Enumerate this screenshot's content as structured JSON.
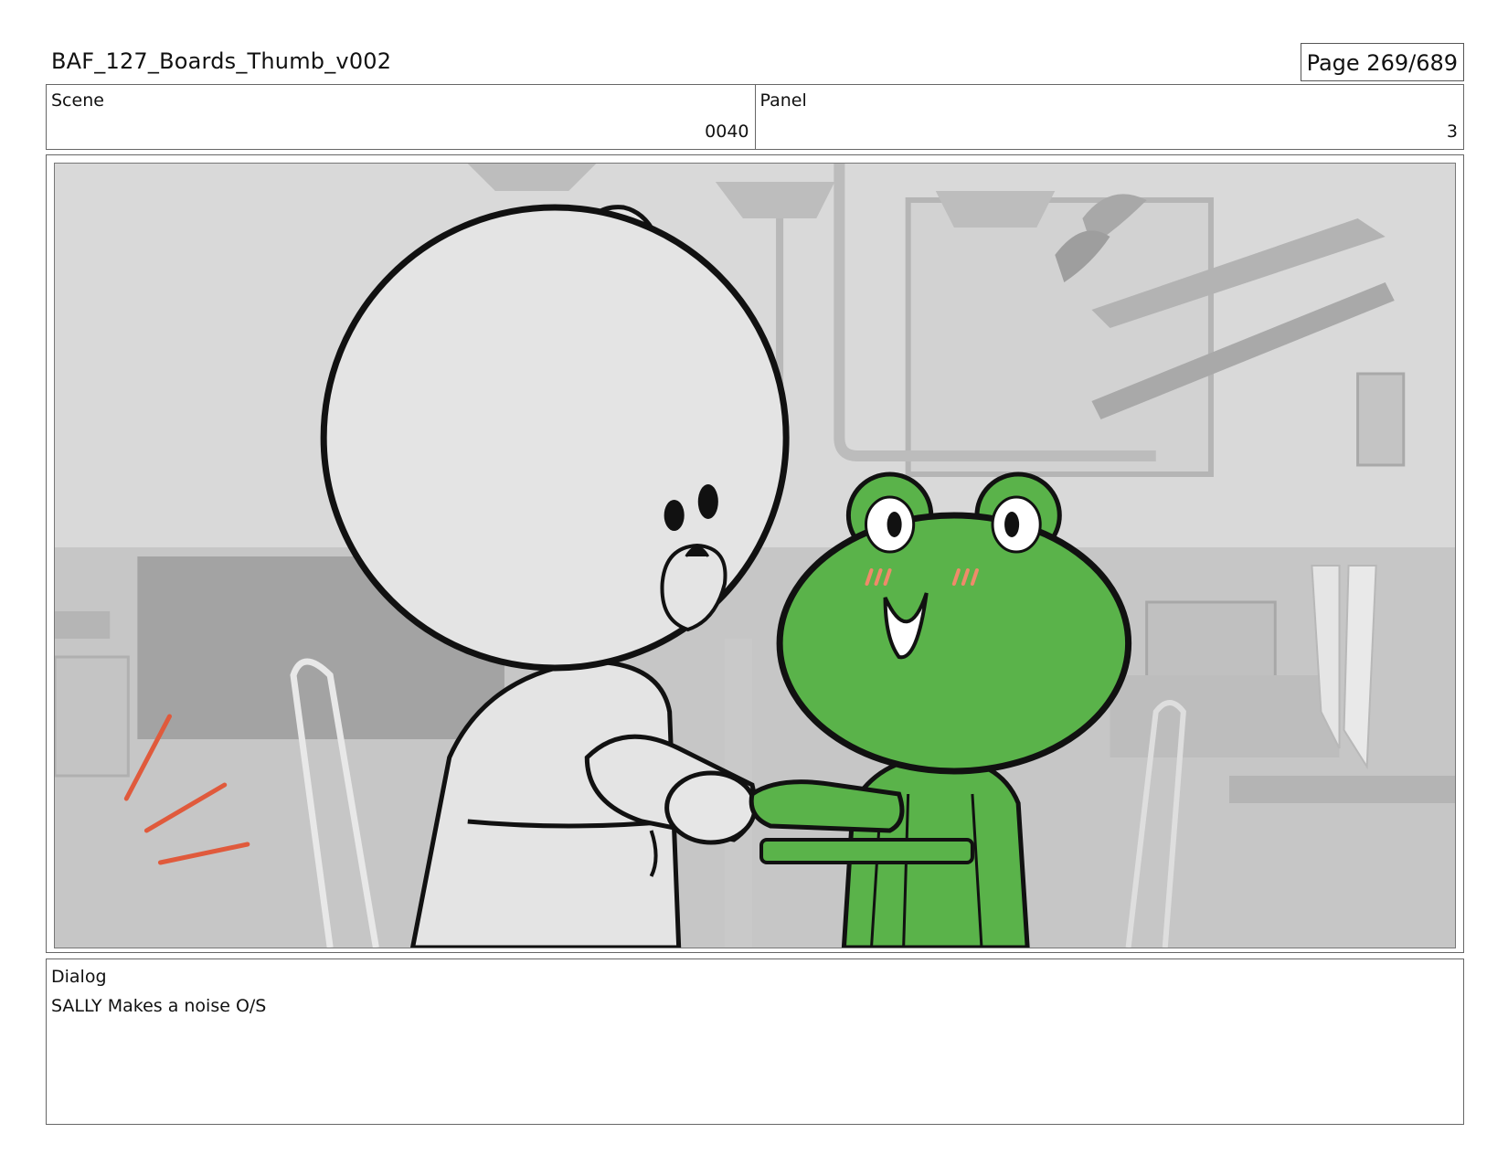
{
  "document": {
    "title": "BAF_127_Boards_Thumb_v002",
    "page_label": "Page 269/689"
  },
  "scene": {
    "label": "Scene",
    "value": "0040"
  },
  "panel": {
    "label": "Panel",
    "value": "3"
  },
  "dialog": {
    "label": "Dialog",
    "text": "SALLY Makes a noise O/S"
  },
  "colors": {
    "frog_green": "#5ab34a",
    "bear_white": "#e4e4e4",
    "background_gray": "#cfcfcf",
    "accent_red": "#e05a3c"
  }
}
